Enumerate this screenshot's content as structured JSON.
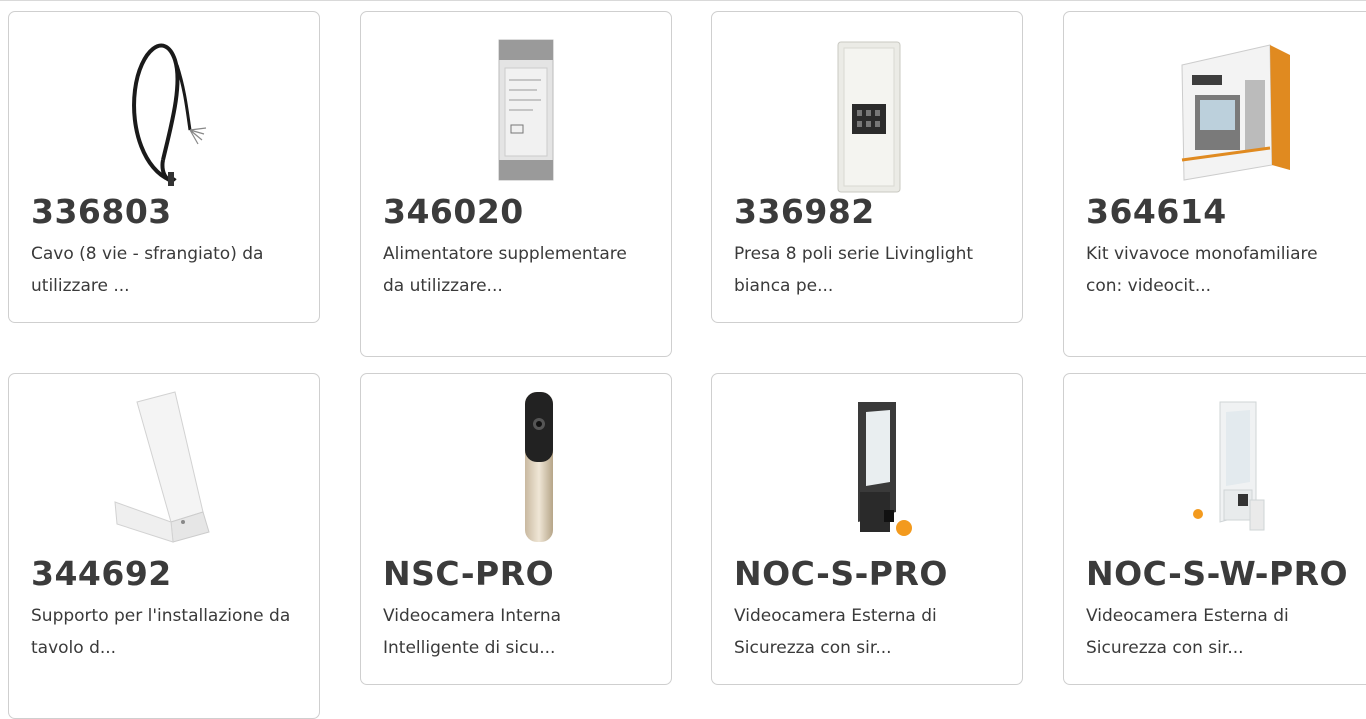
{
  "products": [
    {
      "code": "336803",
      "description": "Cavo (8 vie - sfrangiato) da utilizzare ...",
      "image": "cable-image"
    },
    {
      "code": "346020",
      "description": "Alimentatore supplementare da utilizzare...",
      "image": "power-supply-image"
    },
    {
      "code": "336982",
      "description": "Presa 8 poli serie Livinglight bianca pe...",
      "image": "socket-image"
    },
    {
      "code": "364614",
      "description": "Kit vivavoce monofamiliare con: videocit...",
      "image": "video-kit-box-image"
    },
    {
      "code": "344692",
      "description": "Supporto per l'installazione da tavolo d...",
      "image": "desk-stand-image"
    },
    {
      "code": "NSC-PRO",
      "description": "Videocamera Interna Intelligente di sicu...",
      "image": "indoor-camera-image"
    },
    {
      "code": "NOC-S-PRO",
      "description": "Videocamera Esterna di Sicurezza con sir...",
      "image": "outdoor-camera-black-image"
    },
    {
      "code": "NOC-S-W-PRO",
      "description": "Videocamera Esterna di Sicurezza con sir...",
      "image": "outdoor-camera-white-image"
    }
  ],
  "colors": {
    "border": "#cfcfcf",
    "title": "#3b3b3b",
    "text": "#3a3a3a",
    "accent_orange": "#f39a1e"
  }
}
